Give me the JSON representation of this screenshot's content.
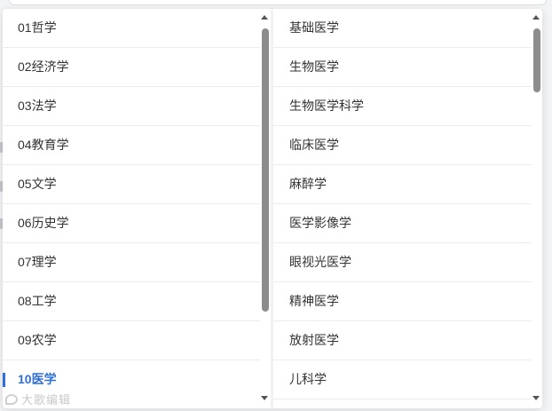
{
  "left_column": {
    "items": [
      {
        "label": "01哲学"
      },
      {
        "label": "02经济学"
      },
      {
        "label": "03法学"
      },
      {
        "label": "04教育学"
      },
      {
        "label": "05文学"
      },
      {
        "label": "06历史学"
      },
      {
        "label": "07理学"
      },
      {
        "label": "08工学"
      },
      {
        "label": "09农学"
      },
      {
        "label": "10医学",
        "selected": true
      }
    ]
  },
  "right_column": {
    "items": [
      {
        "label": "基础医学"
      },
      {
        "label": "生物医学"
      },
      {
        "label": "生物医学科学"
      },
      {
        "label": "临床医学"
      },
      {
        "label": "麻醉学"
      },
      {
        "label": "医学影像学"
      },
      {
        "label": "眼视光医学"
      },
      {
        "label": "精神医学"
      },
      {
        "label": "放射医学"
      },
      {
        "label": "儿科学"
      }
    ]
  },
  "watermark": {
    "text": "大歌编辑"
  },
  "colors": {
    "accent": "#2f6fd6",
    "text": "#333333",
    "scroll_thumb": "#8c8c8c"
  },
  "icons": {
    "scroll_up": "triangle-up",
    "scroll_down": "triangle-down",
    "watermark_logo": "speech-bubble"
  }
}
